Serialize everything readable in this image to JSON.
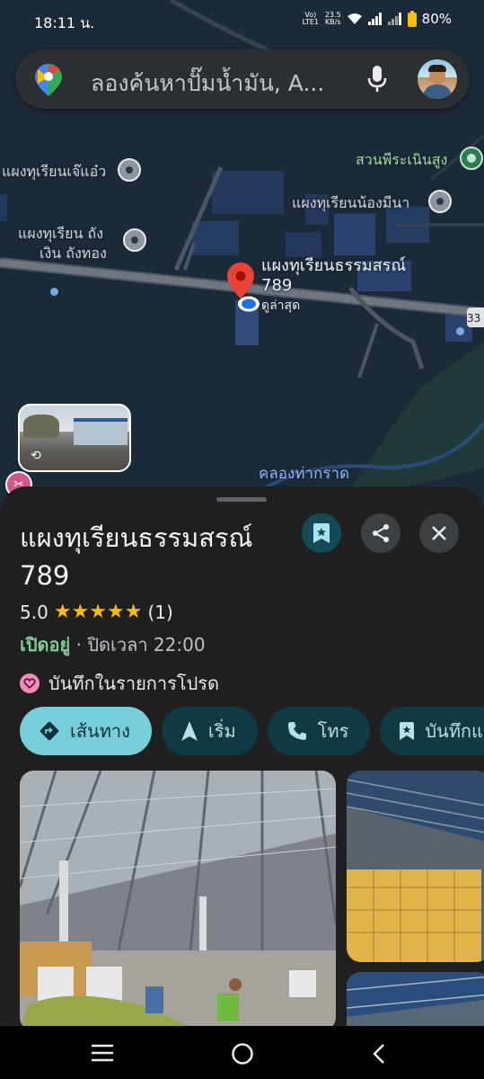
{
  "status_bar": {
    "time": "18:11 น.",
    "volte": "Vo) LTE1",
    "speed_value": "23.5",
    "speed_unit": "KB/s",
    "battery": "80%"
  },
  "search": {
    "placeholder": "ลองค้นหาปั๊มน้ำมัน, A..."
  },
  "map": {
    "labels": {
      "poi_jaew": "แผงทุเรียนเจ๊แอ๋ว",
      "poi_park": "สวนพีระเนินสูง",
      "poi_nongmena": "แผงทุเรียนน้องมีนา",
      "poi_thang_1": "แผงทุเรียน ถัง",
      "poi_thang_2": "เงิน ถังทอง",
      "selected_1": "แผงทุเรียนธรรมสรณ์",
      "selected_2": "789",
      "latest": "ดูล่าสุด",
      "canal": "คลองท่ากราด",
      "road_shield": "33"
    }
  },
  "place": {
    "title": "แผงทุเรียนธรรมสรณ์ 789",
    "rating": "5.0",
    "stars": "★★★★★",
    "review_count": "(1)",
    "open_status": "เปิดอยู่",
    "separator": " · ",
    "close_time": "ปิดเวลา 22:00",
    "favorite_text": "บันทึกในรายการโปรด"
  },
  "actions": {
    "directions": "เส้นทาง",
    "start": "เริ่ม",
    "call": "โทร",
    "save": "บันทึกแ"
  },
  "colors": {
    "accent": "#78cfdc",
    "open_green": "#81c995",
    "star": "#fbbc04",
    "pin_red": "#ea4335"
  }
}
